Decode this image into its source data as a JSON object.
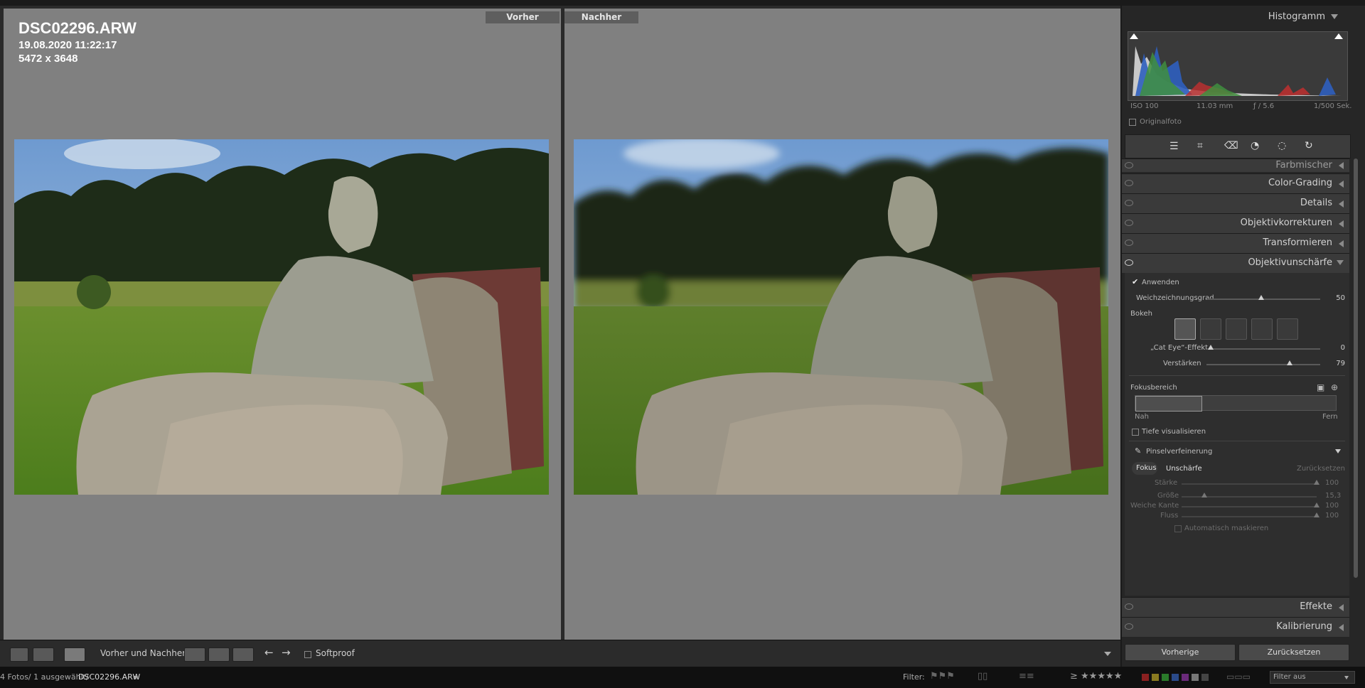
{
  "viewer": {
    "before_label": "Vorher",
    "after_label": "Nachher",
    "file_name": "DSC02296.ARW",
    "timestamp": "19.08.2020 11:22:17",
    "dimensions": "5472 x 3648"
  },
  "toolbar": {
    "view_mode_label": "Vorher und Nachher:",
    "softproof_label": "Softproof"
  },
  "histogram": {
    "title": "Histogramm",
    "iso": "ISO 100",
    "focal": "11.03 mm",
    "aperture": "ƒ / 5.6",
    "shutter": "1/500 Sek.",
    "original_label": "Originalfoto"
  },
  "sections": {
    "farbmischer": "Farbmischer",
    "color_grading": "Color-Grading",
    "details": "Details",
    "objektiv": "Objektivkorrekturen",
    "transformieren": "Transformieren",
    "unschaerfe": "Objektivunschärfe",
    "effekte": "Effekte",
    "kalibrierung": "Kalibrierung"
  },
  "lensblur": {
    "apply_label": "Anwenden",
    "amount_label": "Weichzeichnungsgrad",
    "amount_value": "50",
    "bokeh_label": "Bokeh",
    "cateye_label": "„Cat Eye“-Effekt",
    "cateye_value": "0",
    "boost_label": "Verstärken",
    "boost_value": "79",
    "focus_range_label": "Fokusbereich",
    "near_label": "Nah",
    "far_label": "Fern",
    "visualize_label": "Tiefe visualisieren",
    "refine_label": "Pinselverfeinerung",
    "focus_tab": "Fokus",
    "blur_tab": "Unschärfe",
    "reset_label": "Zurücksetzen",
    "strength_label": "Stärke",
    "strength_value": "100",
    "size_label": "Größe",
    "size_value": "15,3",
    "feather_label": "Weiche Kante",
    "feather_value": "100",
    "flow_label": "Fluss",
    "flow_value": "100",
    "automask_label": "Automatisch maskieren"
  },
  "panel_buttons": {
    "previous": "Vorherige",
    "reset": "Zurücksetzen"
  },
  "statusbar": {
    "count": "4 Fotos/ 1 ausgewählt/",
    "file": "DSC02296.ARW",
    "filter_label": "Filter:",
    "filter_value": "Filter aus"
  },
  "colors": {
    "panel_bg": "#262626",
    "preview_gray": "#808080"
  }
}
